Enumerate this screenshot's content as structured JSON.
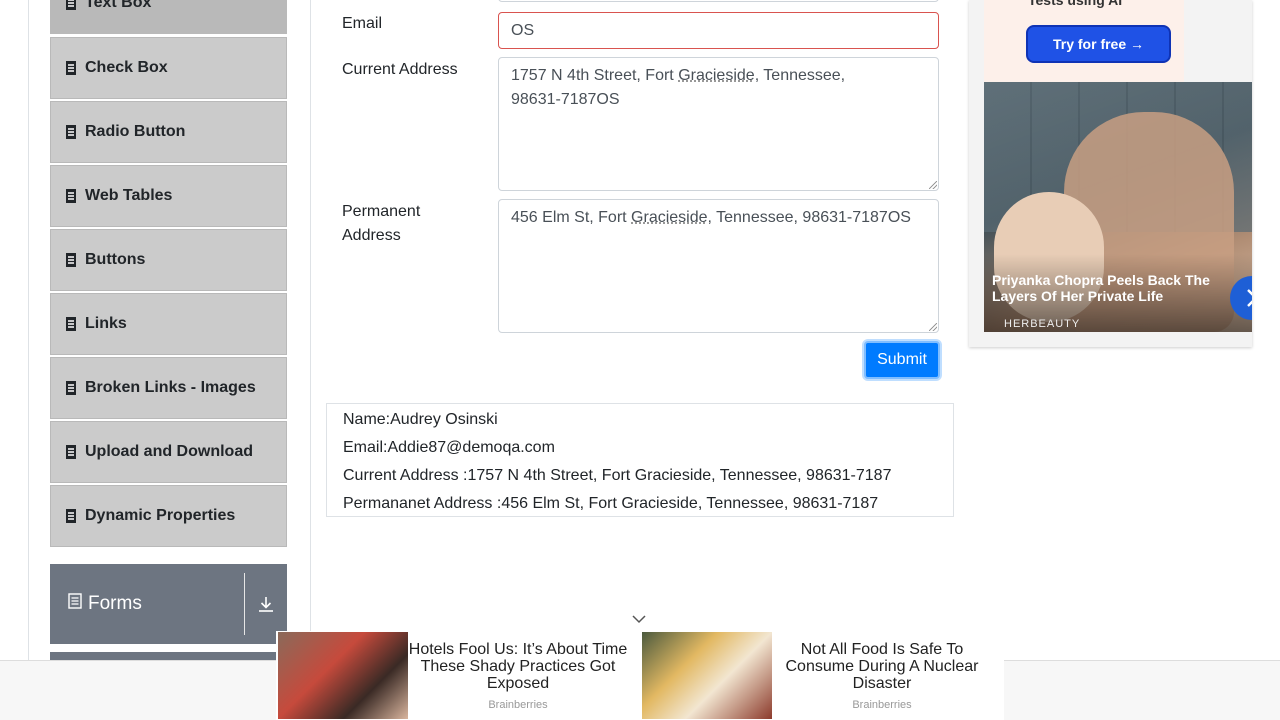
{
  "sidebar": {
    "items": [
      {
        "label": "Text Box"
      },
      {
        "label": "Check Box"
      },
      {
        "label": "Radio Button"
      },
      {
        "label": "Web Tables"
      },
      {
        "label": "Buttons"
      },
      {
        "label": "Links"
      },
      {
        "label": "Broken Links - Images"
      },
      {
        "label": "Upload and Download"
      },
      {
        "label": "Dynamic Properties"
      }
    ],
    "group": {
      "label": "Forms"
    }
  },
  "form": {
    "email": {
      "label": "Email",
      "value": "OS"
    },
    "current_address": {
      "label": "Current Address",
      "value_a": "1757 N 4th Street, Fort ",
      "value_b": "Gracieside",
      "value_c": ", Tennessee, 98631-7187OS"
    },
    "permanent_address": {
      "label": "Permanent Address",
      "value_a": "456 Elm St, Fort ",
      "value_b": "Gracieside",
      "value_c": ", Tennessee, 98631-7187OS"
    },
    "submit_label": "Submit"
  },
  "output": {
    "name": "Name:Audrey Osinski",
    "email": "Email:Addie87@demoqa.com",
    "current_address": "Current Address :1757 N 4th Street, Fort Gracieside, Tennessee, 98631-7187",
    "permanent_address": "Permananet Address :456 Elm St, Fort Gracieside, Tennessee, 98631-7187"
  },
  "ad_right": {
    "top_text": "Tests using AI",
    "button_label": "Try for free →",
    "title": "Priyanka Chopra Peels Back The Layers Of Her Private Life",
    "brand": "HERBEAUTY"
  },
  "ad_bottom": {
    "items": [
      {
        "title": "Hotels Fool Us: It’s About Time These Shady Practices Got Exposed",
        "source": "Brainberries"
      },
      {
        "title": "Not All Food Is Safe To Consume During A Nuclear Disaster",
        "source": "Brainberries"
      }
    ]
  },
  "colors": {
    "primary": "#007bff",
    "error": "#d9534f",
    "menu_bg": "#cbcbcb",
    "group_bg": "#6d7581"
  },
  "icons": [
    "file-icon",
    "form-icon",
    "download-icon",
    "chevron-right-icon",
    "chevron-down-icon"
  ]
}
